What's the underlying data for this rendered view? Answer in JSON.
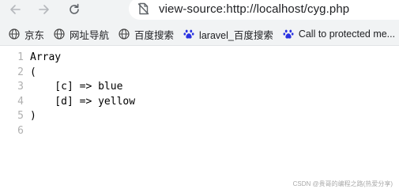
{
  "browser": {
    "url": "view-source:http://localhost/cyg.php",
    "icons": {
      "back": "arrow-left-icon",
      "forward": "arrow-right-icon",
      "reload": "reload-icon",
      "site": "not-secure-icon"
    }
  },
  "bookmarks": [
    {
      "label": "京东",
      "icon": "globe-icon"
    },
    {
      "label": "网址导航",
      "icon": "globe-icon"
    },
    {
      "label": "百度搜索",
      "icon": "globe-icon"
    },
    {
      "label": "laravel_百度搜索",
      "icon": "baidu-paw-icon"
    },
    {
      "label": "Call to protected me...",
      "icon": "baidu-paw-icon"
    }
  ],
  "source": {
    "lines": [
      {
        "number": "1",
        "text": "Array"
      },
      {
        "number": "2",
        "text": "("
      },
      {
        "number": "3",
        "text": "    [c] => blue"
      },
      {
        "number": "4",
        "text": "    [d] => yellow"
      },
      {
        "number": "5",
        "text": ")"
      },
      {
        "number": "6",
        "text": ""
      }
    ]
  },
  "watermark": "CSDN @贵哥的编程之路(热爱分享)",
  "colors": {
    "chrome_bg": "#f1f3f4",
    "line_number": "#b0b0b0",
    "baidu_blue": "#2932e1"
  }
}
